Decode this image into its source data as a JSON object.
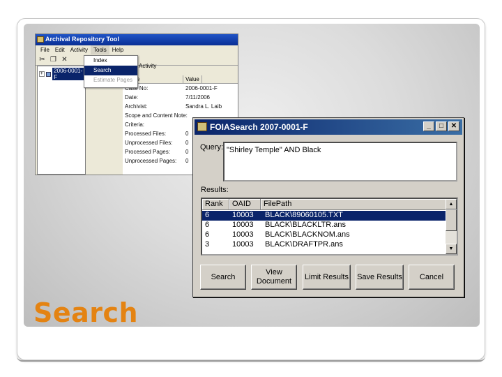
{
  "slide": {
    "title": "Search",
    "accent_color": "#e48312"
  },
  "archival_window": {
    "title": "Archival Repository Tool",
    "menu": [
      "File",
      "Edit",
      "Activity",
      "Tools",
      "Help"
    ],
    "toolbar_icons": [
      "cut-icon",
      "copy-icon",
      "delete-icon"
    ],
    "activity_label_fragment": "Activity",
    "tree_node": "2006-0001-F",
    "tools_menu": {
      "items": [
        "Index",
        "Search",
        "Estimate Pages"
      ],
      "selected": "Search",
      "disabled": "Estimate Pages"
    },
    "properties": {
      "columns": [
        "Name",
        "Value"
      ],
      "rows": [
        {
          "name": "Case No:",
          "value": "2006-0001-F"
        },
        {
          "name": "Date:",
          "value": "7/11/2006"
        },
        {
          "name": "Archivist:",
          "value": "Sandra L. Laib"
        },
        {
          "name": "Scope and Content Note:",
          "value": ""
        },
        {
          "name": "Criteria:",
          "value": ""
        },
        {
          "name": "Processed Files:",
          "value": "0"
        },
        {
          "name": "Unprocessed Files:",
          "value": "0"
        },
        {
          "name": "Processed Pages:",
          "value": "0"
        },
        {
          "name": "Unprocessed Pages:",
          "value": "0"
        }
      ]
    }
  },
  "foia_dialog": {
    "title": "FOIASearch 2007-0001-F",
    "window_buttons": [
      "_",
      "□",
      "✕"
    ],
    "query_label": "Query:",
    "query_value": "\"Shirley Temple\" AND Black",
    "results_label": "Results:",
    "columns": [
      "Rank",
      "OAID",
      "FilePath"
    ],
    "rows": [
      {
        "rank": "6",
        "oaid": "10003",
        "path": "BLACK\\89060105.TXT",
        "selected": true
      },
      {
        "rank": "6",
        "oaid": "10003",
        "path": "BLACK\\BLACKLTR.ans",
        "selected": false
      },
      {
        "rank": "6",
        "oaid": "10003",
        "path": "BLACK\\BLACKNOM.ans",
        "selected": false
      },
      {
        "rank": "3",
        "oaid": "10003",
        "path": "BLACK\\DRAFTPR.ans",
        "selected": false
      }
    ],
    "buttons": {
      "search": "Search",
      "view_document_line1": "View",
      "view_document_line2": "Document",
      "limit_results": "Limit Results",
      "save_results": "Save Results",
      "cancel": "Cancel"
    }
  }
}
